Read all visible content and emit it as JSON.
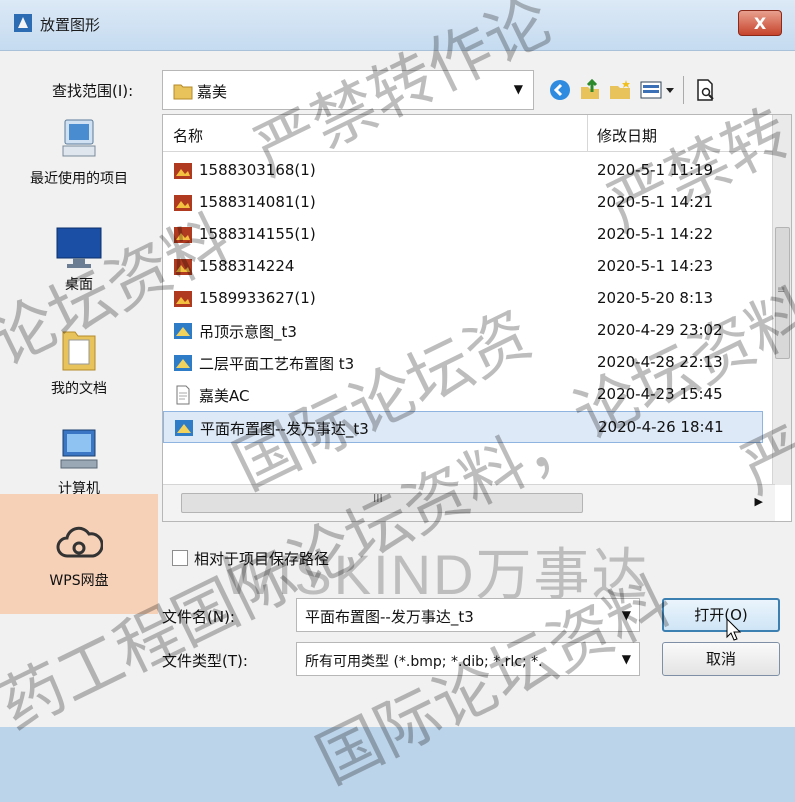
{
  "window": {
    "title": "放置图形",
    "close_label": "X"
  },
  "lookin": {
    "label": "查找范围(I):",
    "value": "嘉美",
    "arrow": "▼"
  },
  "toolbar": {
    "icons": [
      "back-icon",
      "up-folder-icon",
      "new-folder-icon",
      "views-menu-icon",
      "preview-icon"
    ]
  },
  "places": [
    {
      "label": "最近使用的项目",
      "icon": "recent-items-icon"
    },
    {
      "label": "桌面",
      "icon": "desktop-icon"
    },
    {
      "label": "我的文档",
      "icon": "documents-icon"
    },
    {
      "label": "计算机",
      "icon": "computer-icon"
    },
    {
      "label": "WPS网盘",
      "icon": "cloud-drive-icon"
    }
  ],
  "filelist": {
    "headers": {
      "name": "名称",
      "date": "修改日期"
    },
    "rows": [
      {
        "name": "1588303168(1)",
        "date": "2020-5-1 11:19",
        "type": "image"
      },
      {
        "name": "1588314081(1)",
        "date": "2020-5-1 14:21",
        "type": "image"
      },
      {
        "name": "1588314155(1)",
        "date": "2020-5-1 14:22",
        "type": "image"
      },
      {
        "name": "1588314224",
        "date": "2020-5-1 14:23",
        "type": "image"
      },
      {
        "name": "1589933627(1)",
        "date": "2020-5-20 8:13",
        "type": "image"
      },
      {
        "name": "吊顶示意图_t3",
        "date": "2020-4-29 23:02",
        "type": "drawing"
      },
      {
        "name": "二层平面工艺布置图 t3",
        "date": "2020-4-28 22:13",
        "type": "drawing"
      },
      {
        "name": "嘉美AC",
        "date": "2020-4-23 15:45",
        "type": "document"
      },
      {
        "name": "平面布置图--发万事达_t3",
        "date": "2020-4-26 18:41",
        "type": "drawing",
        "selected": true
      }
    ]
  },
  "hscroll_grip": "III",
  "hscroll_arrow": "▶",
  "vscroll_grip": "≡",
  "checkbox": {
    "label": "相对于项目保存路径",
    "checked": false
  },
  "brand_watermark": "WISKIND万事达",
  "filename": {
    "label": "文件名(N):",
    "value": "平面布置图--发万事达_t3",
    "arrow": "▼"
  },
  "filetype": {
    "label": "文件类型(T):",
    "value": "所有可用类型 (*.bmp; *.dib; *.rlc; *.",
    "arrow": "▼"
  },
  "buttons": {
    "open": "打开(O)",
    "cancel": "取消"
  },
  "watermarks": [
    "严禁转作论",
    "严禁转",
    "论坛资料",
    "论坛资料，",
    "国际论坛资",
    "药工程国际论坛资料，",
    "国际论坛资料",
    "严"
  ]
}
